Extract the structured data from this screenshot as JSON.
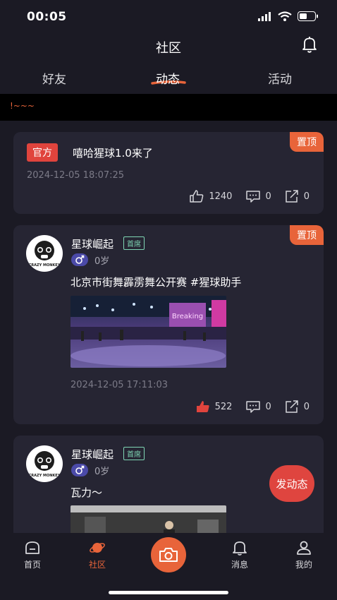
{
  "status_bar": {
    "time": "00:05"
  },
  "header": {
    "title": "社区"
  },
  "tabs": [
    {
      "label": "好友"
    },
    {
      "label": "动态"
    },
    {
      "label": "活动"
    }
  ],
  "notice": {
    "text": "!~~~"
  },
  "posts": [
    {
      "pinned_label": "置顶",
      "official_label": "官方",
      "title": "嘻哈猩球1.0来了",
      "date": "2024-12-05 18:07:25",
      "likes": "1240",
      "comments": "0",
      "shares": "0"
    },
    {
      "pinned_label": "置顶",
      "username": "星球崛起",
      "tag": "首席",
      "age": "0岁",
      "text": "北京市街舞霹雳舞公开赛 #猩球助手",
      "date": "2024-12-05 17:11:03",
      "likes": "522",
      "comments": "0",
      "shares": "0",
      "avatar_text": "CRAZY MONKEY",
      "image_sign": "Breaking"
    },
    {
      "username": "星球崛起",
      "tag": "首席",
      "age": "0岁",
      "text": "瓦力～",
      "avatar_text": "CRAZY MONKEY"
    }
  ],
  "fab": {
    "label": "发动态"
  },
  "bottom_nav": [
    {
      "label": "首页"
    },
    {
      "label": "社区"
    },
    {
      "label": "消息"
    },
    {
      "label": "我的"
    }
  ],
  "colors": {
    "accent": "#e8643a",
    "background": "#1b1a24",
    "card": "#262533",
    "official": "#e0443d"
  }
}
